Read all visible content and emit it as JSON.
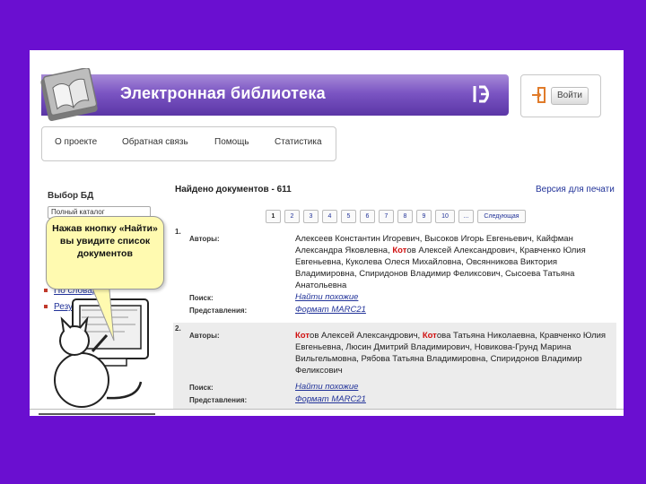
{
  "header": {
    "title": "Электронная библиотека"
  },
  "login": {
    "button_label": "Войти"
  },
  "nav": {
    "items": [
      "О проекте",
      "Обратная связь",
      "Помощь",
      "Статистика"
    ]
  },
  "left": {
    "db_title": "Выбор БД",
    "db_selected": "Полный каталог",
    "links": [
      "По словарям",
      "Результаты поиска"
    ]
  },
  "callout": {
    "text": "Нажав кнопку «Найти» вы увидите список документов"
  },
  "results": {
    "found": "Найдено документов - 611",
    "print_version": "Версия для печати",
    "pager": [
      "1",
      "2",
      "3",
      "4",
      "5",
      "6",
      "7",
      "8",
      "9",
      "10",
      "...",
      "Следующая"
    ],
    "labels": {
      "authors": "Авторы:",
      "search": "Поиск:",
      "views": "Представления:"
    },
    "records": [
      {
        "num": "1.",
        "authors_before": "Алексеев Константин Игоревич, Высоков Игорь Евгеньевич, Кайфман Александра Яковлевна, ",
        "hl": "Кот",
        "authors_after": "ов Алексей Александрович, Кравченко Юлия Евгеньевна, Куколева Олеся Михайловна, Овсянникова Виктория Владимировна, Спиридонов Владимир Феликсович, Сысоева Татьяна Анатольевна",
        "search_link": "Найти похожие",
        "view_link": "Формат MARC21"
      },
      {
        "num": "2.",
        "authors_before": "",
        "hl": "Кот",
        "authors_after": "ов Алексей Александрович, ",
        "hl2": "Кот",
        "authors_after2": "ова Татьяна Николаевна, Кравченко Юлия Евгеньевна, Люсин Дмитрий Владимирович, Новикова-Грунд Марина Вильгельмовна, Рябова Татьяна Владимировна, Спиридонов Владимир Феликсович",
        "search_link": "Найти похожие",
        "view_link": "Формат MARC21"
      }
    ]
  },
  "colors": {
    "background": "#6a0fd0",
    "banner": "#7b55c3",
    "highlight": "#d01010",
    "link": "#223399"
  },
  "icons": [
    "book-icon",
    "library-logo-icon",
    "login-icon"
  ]
}
